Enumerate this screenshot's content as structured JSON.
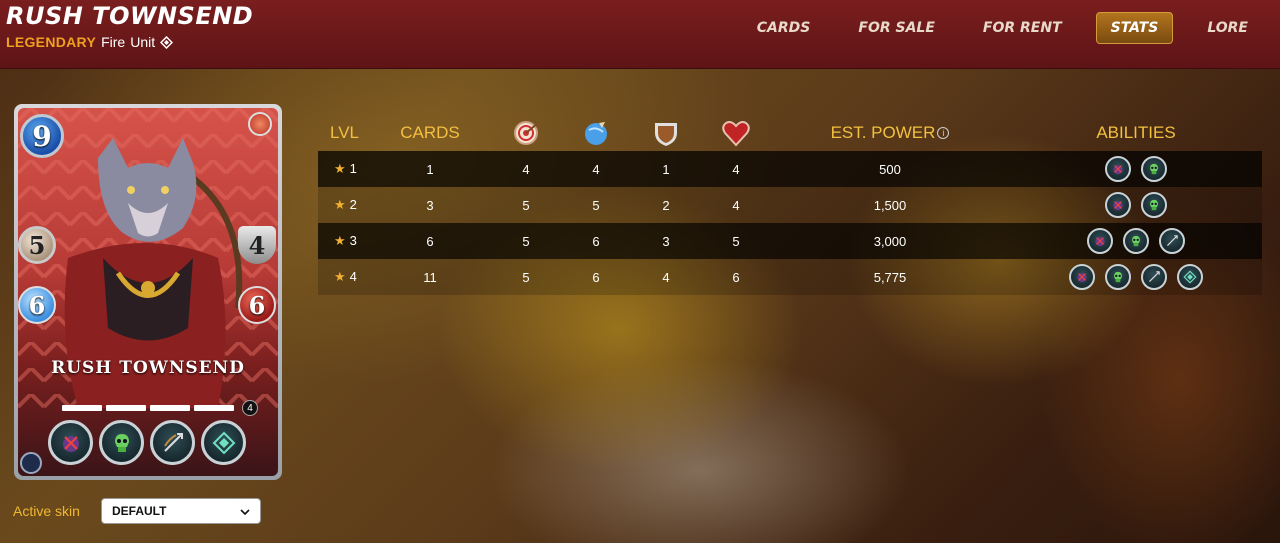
{
  "header": {
    "title": "RUSH TOWNSEND",
    "rarity": "LEGENDARY",
    "element": "Fire",
    "unit": "Unit",
    "tabs": [
      {
        "label": "CARDS",
        "active": false
      },
      {
        "label": "FOR SALE",
        "active": false
      },
      {
        "label": "FOR RENT",
        "active": false
      },
      {
        "label": "STATS",
        "active": true
      },
      {
        "label": "LORE",
        "active": false
      }
    ]
  },
  "card": {
    "name": "RUSH TOWNSEND",
    "mana": "9",
    "attack": "5",
    "speed": "6",
    "armor": "4",
    "health": "6",
    "level": "4",
    "abilities": [
      "poison-icon",
      "skull-icon",
      "bow-icon",
      "rune-icon"
    ]
  },
  "skin": {
    "label": "Active skin",
    "value": "DEFAULT"
  },
  "stats": {
    "headers": {
      "lvl": "LVL",
      "cards": "CARDS",
      "power": "EST. POWER",
      "abilities": "ABILITIES",
      "attack_icon": "target-icon",
      "speed_icon": "speed-icon",
      "armor_icon": "shield-icon",
      "health_icon": "heart-icon"
    },
    "rows": [
      {
        "lvl": "1",
        "cards": "1",
        "attack": "4",
        "speed": "4",
        "armor": "1",
        "health": "4",
        "power": "500",
        "abilities": [
          "poison-icon",
          "skull-icon"
        ]
      },
      {
        "lvl": "2",
        "cards": "3",
        "attack": "5",
        "speed": "5",
        "armor": "2",
        "health": "4",
        "power": "1,500",
        "abilities": [
          "poison-icon",
          "skull-icon"
        ]
      },
      {
        "lvl": "3",
        "cards": "6",
        "attack": "5",
        "speed": "6",
        "armor": "3",
        "health": "5",
        "power": "3,000",
        "abilities": [
          "poison-icon",
          "skull-icon",
          "bow-icon"
        ]
      },
      {
        "lvl": "4",
        "cards": "11",
        "attack": "5",
        "speed": "6",
        "armor": "4",
        "health": "6",
        "power": "5,775",
        "abilities": [
          "poison-icon",
          "skull-icon",
          "bow-icon",
          "rune-icon"
        ]
      }
    ]
  },
  "colors": {
    "header_bg": "#6e1a1c",
    "accent_gold": "#f2c040",
    "rarity_orange": "#f0a020",
    "active_tab": "#9a621a"
  }
}
